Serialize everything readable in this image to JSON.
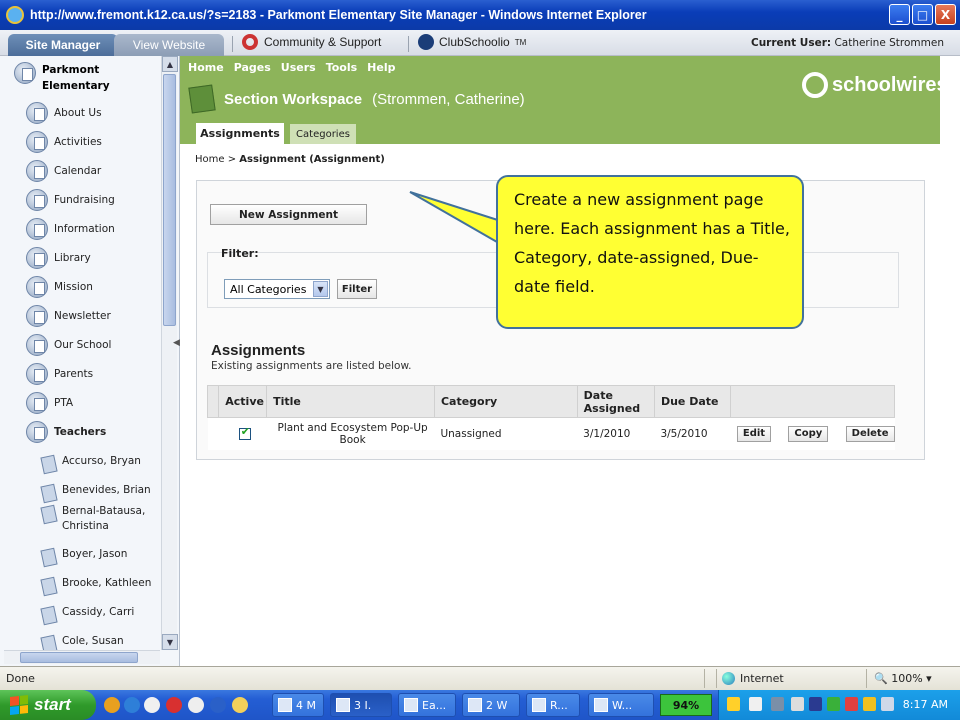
{
  "window": {
    "title": "http://www.fremont.k12.ca.us/?s=2183 - Parkmont Elementary Site Manager - Windows Internet Explorer",
    "buttons": [
      "_",
      "□",
      "X"
    ]
  },
  "topbar": {
    "site_manager_tab": "Site Manager",
    "view_website_tab": "View Website",
    "community_link": "Community & Support",
    "club_link": "ClubSchoolio",
    "club_tm": "TM",
    "current_user_label": "Current User:",
    "current_user_name": "Catherine Strommen"
  },
  "sidebar": {
    "root_line1": "Parkmont",
    "root_line2": "Elementary",
    "pages": [
      "About Us",
      "Activities",
      "Calendar",
      "Fundraising",
      "Information",
      "Library",
      "Mission",
      "Newsletter",
      "Our School",
      "Parents",
      "PTA",
      "Teachers"
    ],
    "teachers": [
      [
        "Accurso, Bryan"
      ],
      [
        "Benevides, Brian"
      ],
      [
        "Bernal-Batausa,",
        "Christina"
      ],
      [
        "Boyer, Jason"
      ],
      [
        "Brooke, Kathleen"
      ],
      [
        "Cassidy, Carri"
      ],
      [
        "Cole, Susan"
      ]
    ]
  },
  "nav": {
    "items": [
      "Home",
      "Pages",
      "Users",
      "Tools",
      "Help"
    ],
    "workspace_title": "Section Workspace",
    "workspace_owner": "(Strommen, Catherine)",
    "brand": "schoolwires",
    "brand_mark": "®",
    "tabs": [
      "Assignments",
      "Categories"
    ]
  },
  "content": {
    "breadcrumb_home": "Home",
    "breadcrumb_sep": ">",
    "breadcrumb_current": "Assignment (Assignment)",
    "new_button": "New Assignment",
    "filter_label": "Filter:",
    "filter_selected": "All Categories",
    "filter_button": "Filter",
    "heading": "Assignments",
    "subheading": "Existing assignments are listed below.",
    "columns": [
      "Active",
      "Title",
      "Category",
      "Date Assigned",
      "Due Date"
    ],
    "rows": [
      {
        "active": true,
        "title": "Plant and Ecosystem Pop-Up Book",
        "category": "Unassigned",
        "date_assigned": "3/1/2010",
        "due_date": "3/5/2010",
        "actions": [
          "Edit",
          "Copy",
          "Delete"
        ]
      }
    ]
  },
  "callout": {
    "text": "Create a new assignment page here. Each assignment has a Title, Category, date-assigned, Due-date field."
  },
  "statusbar": {
    "status": "Done",
    "zone": "Internet",
    "zoom": "100%"
  },
  "taskbar": {
    "start": "start",
    "tasks": [
      "4 M",
      "3 I.",
      "Ea...",
      "2 W",
      "R...",
      "W..."
    ],
    "battery": "94%",
    "clock": "8:17 AM"
  },
  "colors": {
    "green_header": "#8db45a",
    "callout_fill": "#ffff33",
    "callout_border": "#41719c"
  }
}
